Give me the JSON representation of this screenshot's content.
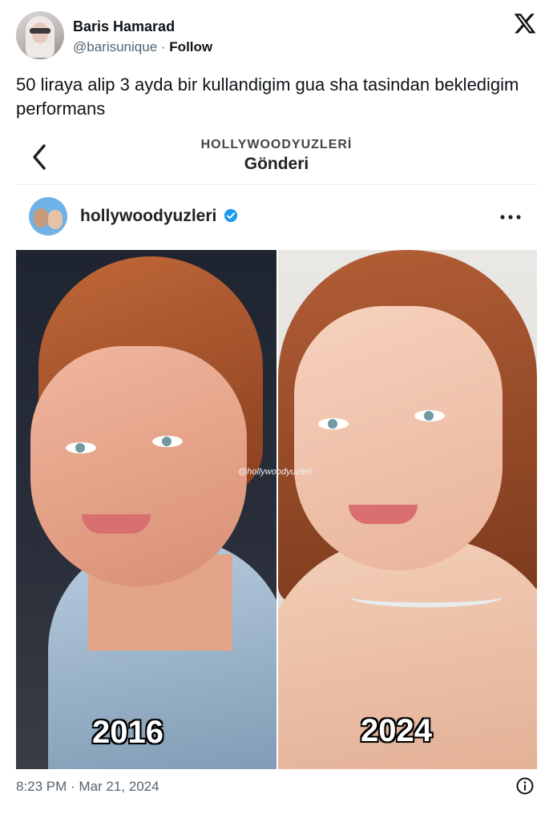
{
  "tweet": {
    "author": {
      "name": "Baris Hamarad",
      "handle": "@barisunique",
      "separator": "·",
      "follow_label": "Follow"
    },
    "text": "50 liraya alip 3 ayda bir kullandigim gua sha tasindan bekledigim performans",
    "timestamp": "8:23 PM · Mar 21, 2024",
    "icons": {
      "platform": "x-logo-icon",
      "info": "info-icon"
    }
  },
  "embedded_post": {
    "account_header": "HOLLYWOODYUZLERİ",
    "page_title": "Gönderi",
    "username": "hollywoodyuzleri",
    "verified": true,
    "watermark": "@hollywoodyuzleri",
    "photos": [
      {
        "label": "2016"
      },
      {
        "label": "2024"
      }
    ],
    "icons": {
      "back": "chevron-left-icon",
      "more": "more-options-icon",
      "verified": "verified-badge-icon"
    }
  },
  "colors": {
    "text_primary": "#0f1419",
    "text_secondary": "#536471",
    "verified_blue": "#1d9bf0"
  }
}
